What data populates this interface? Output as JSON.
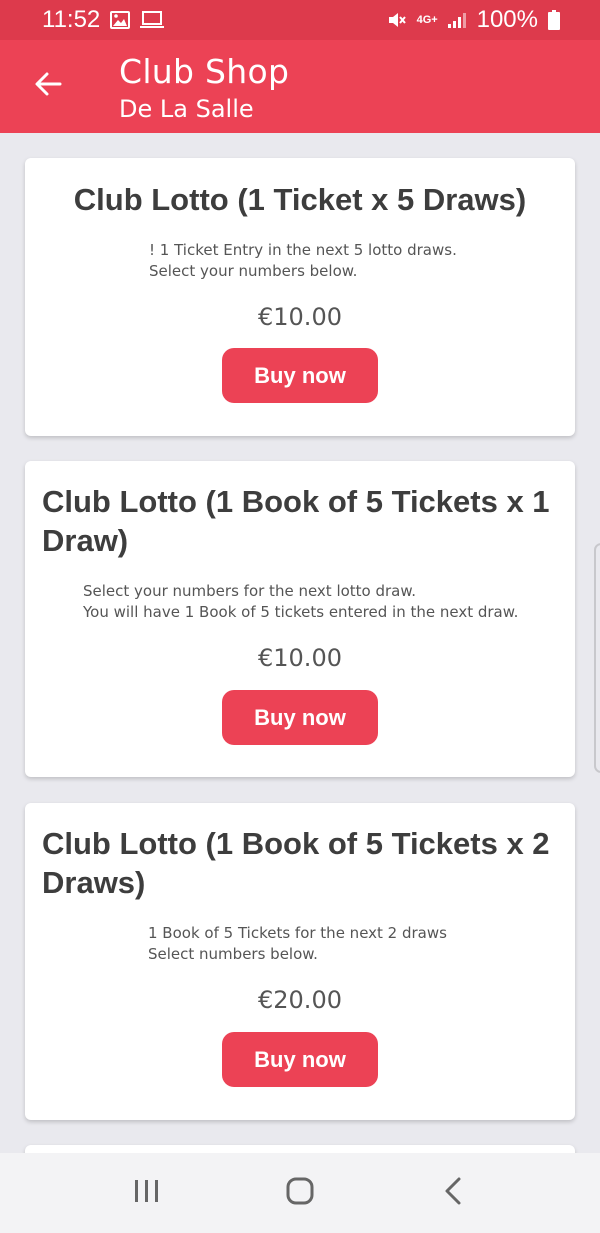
{
  "status_bar": {
    "time": "11:52",
    "network": "4G+",
    "battery": "100%"
  },
  "app_bar": {
    "title": "Club Shop",
    "subtitle": "De La Salle"
  },
  "products": [
    {
      "title": "Club Lotto (1 Ticket x 5 Draws)",
      "description_lines": [
        "! 1 Ticket Entry in the next 5 lotto draws.",
        "Select your numbers below."
      ],
      "price": "€10.00",
      "button_label": "Buy now"
    },
    {
      "title": "Club Lotto (1 Book of 5 Tickets x 1 Draw)",
      "description_lines": [
        "Select your numbers for the next lotto draw.",
        "You will have 1 Book of 5 tickets entered in the next draw."
      ],
      "price": "€10.00",
      "button_label": "Buy now"
    },
    {
      "title": "Club Lotto (1 Book of 5 Tickets x 2 Draws)",
      "description_lines": [
        "1 Book of 5 Tickets for the next 2 draws",
        "Select numbers below."
      ],
      "price": "€20.00",
      "button_label": "Buy now"
    }
  ],
  "icons": {
    "back": "arrow-left-icon",
    "nav_recents": "recents-icon",
    "nav_home": "home-icon",
    "nav_back": "back-chevron-icon"
  },
  "colors": {
    "accent": "#ec4255",
    "status_bar": "#dd3a4c",
    "background": "#e9e9ee"
  }
}
